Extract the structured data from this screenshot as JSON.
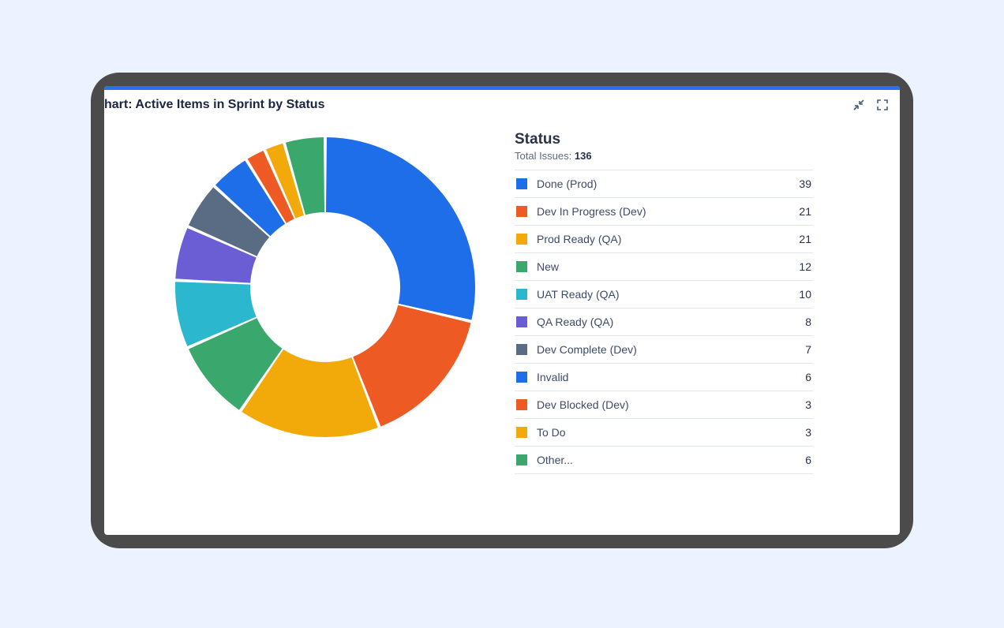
{
  "title_prefix": "hart: ",
  "title_main": "Active Items in Sprint by Status",
  "legend_title": "Status",
  "total_label": "Total Issues: ",
  "total_value": "136",
  "items": [
    {
      "label": "Done (Prod)",
      "count": "39",
      "color": "#1e6eea"
    },
    {
      "label": "Dev In Progress (Dev)",
      "count": "21",
      "color": "#ee5a24"
    },
    {
      "label": "Prod Ready (QA)",
      "count": "21",
      "color": "#f2a90a"
    },
    {
      "label": "New",
      "count": "12",
      "color": "#3aa76d"
    },
    {
      "label": "UAT Ready (QA)",
      "count": "10",
      "color": "#2bb8cf"
    },
    {
      "label": "QA Ready (QA)",
      "count": "8",
      "color": "#6b5dd3"
    },
    {
      "label": "Dev Complete (Dev)",
      "count": "7",
      "color": "#5a6b84"
    },
    {
      "label": "Invalid",
      "count": "6",
      "color": "#1e6eea"
    },
    {
      "label": "Dev Blocked (Dev)",
      "count": "3",
      "color": "#ee5a24"
    },
    {
      "label": "To Do",
      "count": "3",
      "color": "#f2a90a"
    },
    {
      "label": "Other...",
      "count": "6",
      "color": "#3aa76d"
    }
  ],
  "chart_data": {
    "type": "pie",
    "title": "Active Items in Sprint by Status",
    "donut": true,
    "total": 136,
    "series": [
      {
        "name": "Done (Prod)",
        "value": 39,
        "color": "#1e6eea"
      },
      {
        "name": "Dev In Progress (Dev)",
        "value": 21,
        "color": "#ee5a24"
      },
      {
        "name": "Prod Ready (QA)",
        "value": 21,
        "color": "#f2a90a"
      },
      {
        "name": "New",
        "value": 12,
        "color": "#3aa76d"
      },
      {
        "name": "UAT Ready (QA)",
        "value": 10,
        "color": "#2bb8cf"
      },
      {
        "name": "QA Ready (QA)",
        "value": 8,
        "color": "#6b5dd3"
      },
      {
        "name": "Dev Complete (Dev)",
        "value": 7,
        "color": "#5a6b84"
      },
      {
        "name": "Invalid",
        "value": 6,
        "color": "#1e6eea"
      },
      {
        "name": "Dev Blocked (Dev)",
        "value": 3,
        "color": "#ee5a24"
      },
      {
        "name": "To Do",
        "value": 3,
        "color": "#f2a90a"
      },
      {
        "name": "Other...",
        "value": 6,
        "color": "#3aa76d"
      }
    ]
  }
}
